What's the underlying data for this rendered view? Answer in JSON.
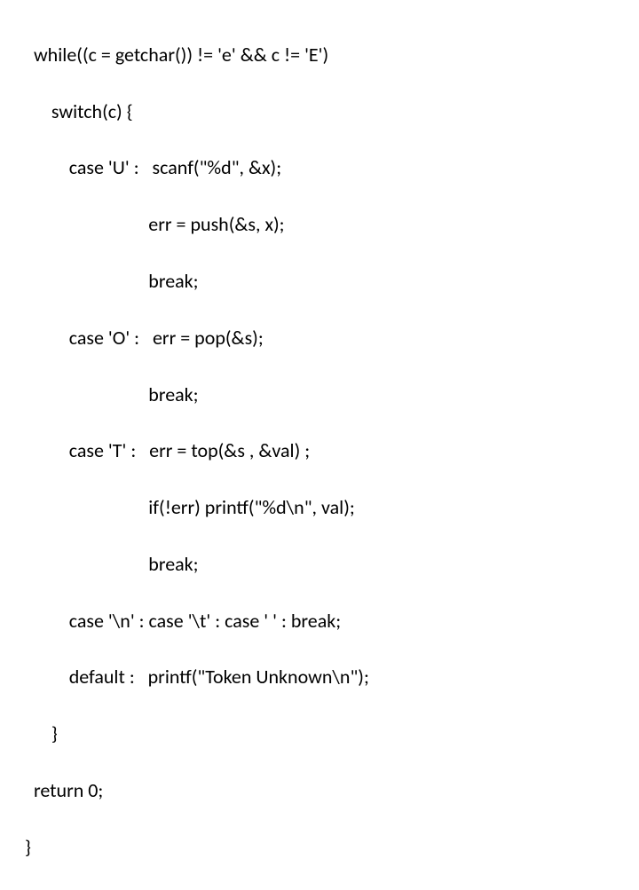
{
  "code": {
    "l01": "  while((c = getchar()) != 'e' && c != 'E')",
    "l02": "      switch(c) {",
    "l03": "          case 'U' :   scanf(\"%d\", &x);",
    "l04": "                            err = push(&s, x);",
    "l05": "                            break;",
    "l06": "          case 'O' :   err = pop(&s);",
    "l07": "                            break;",
    "l08": "          case 'T' :   err = top(&s , &val) ;",
    "l09": "                            if(!err) printf(\"%d\\n\", val);",
    "l10": "                            break;",
    "l11": "          case '\\n' : case '\\t' : case ' ' : break;",
    "l12": "          default :   printf(\"Token Unknown\\n\");",
    "l13": "      }",
    "l14": "  return 0;",
    "l15": "}"
  }
}
